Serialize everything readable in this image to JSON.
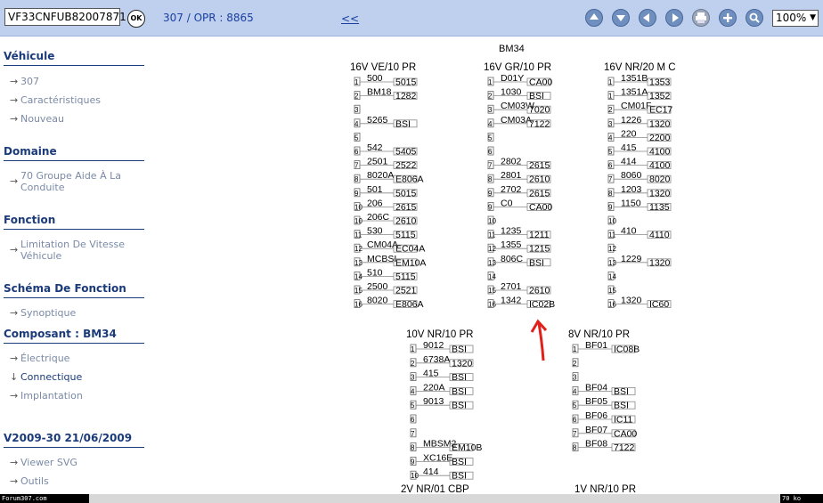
{
  "toolbar": {
    "vin": "VF33CNFUB82007871",
    "ok_label": "OK",
    "breadcrumb": "307  /  OPR : 8865",
    "back_link": "<<",
    "zoom": "100%",
    "buttons": [
      "arrow-up-icon",
      "arrow-down-icon",
      "arrow-left-icon",
      "arrow-right-icon",
      "print-icon",
      "plus-icon",
      "magnifier-icon"
    ]
  },
  "sidebar": {
    "vehicule": {
      "title": "Véhicule",
      "items": [
        "307",
        "Caractéristiques",
        "Nouveau"
      ]
    },
    "domaine": {
      "title": "Domaine",
      "items": [
        "70 Groupe Aide À La Conduite"
      ]
    },
    "fonction": {
      "title": "Fonction",
      "items": [
        "Limitation De Vitesse Véhicule"
      ]
    },
    "schema": {
      "title": "Schéma De Fonction",
      "items": [
        "Synoptique"
      ]
    },
    "composant": {
      "title": "Composant : BM34",
      "items": [
        "Électrique",
        "Connectique",
        "Implantation"
      ]
    },
    "version": {
      "title": "V2009-30 21/06/2009",
      "items": [
        "Viewer SVG",
        "Outils"
      ]
    }
  },
  "status": {
    "left": "Forum307.com",
    "right": "70 ko"
  },
  "diagram": {
    "component": "BM34",
    "connectors": [
      {
        "title": "16V VE/10 PR",
        "pins": [
          {
            "n": "1",
            "wire": "500",
            "dest": "5015"
          },
          {
            "n": "2",
            "wire": "BM18",
            "dest": "1282"
          },
          {
            "n": "3",
            "wire": "",
            "dest": ""
          },
          {
            "n": "4",
            "wire": "5265",
            "dest": "BSI"
          },
          {
            "n": "5",
            "wire": "",
            "dest": ""
          },
          {
            "n": "6",
            "wire": "542",
            "dest": "5405"
          },
          {
            "n": "7",
            "wire": "2501",
            "dest": "2522"
          },
          {
            "n": "8",
            "wire": "8020A",
            "dest": "E806A"
          },
          {
            "n": "9",
            "wire": "501",
            "dest": "5015"
          },
          {
            "n": "10",
            "wire": "206",
            "dest": "2615"
          },
          {
            "n": "10",
            "wire": "206C",
            "dest": "2610"
          },
          {
            "n": "11",
            "wire": "530",
            "dest": "5115"
          },
          {
            "n": "12",
            "wire": "CM04A",
            "dest": "EC04A"
          },
          {
            "n": "13",
            "wire": "MCBSI",
            "dest": "EM10A"
          },
          {
            "n": "14",
            "wire": "510",
            "dest": "5115"
          },
          {
            "n": "15",
            "wire": "2500",
            "dest": "2521"
          },
          {
            "n": "16",
            "wire": "8020",
            "dest": "E806A"
          }
        ]
      },
      {
        "title": "16V GR/10 PR",
        "pins": [
          {
            "n": "1",
            "wire": "D01Y",
            "dest": "CA00"
          },
          {
            "n": "2",
            "wire": "1030",
            "dest": "BSI"
          },
          {
            "n": "3",
            "wire": "CM03W",
            "dest": "7020"
          },
          {
            "n": "4",
            "wire": "CM03A",
            "dest": "7122"
          },
          {
            "n": "5",
            "wire": "",
            "dest": ""
          },
          {
            "n": "6",
            "wire": "",
            "dest": ""
          },
          {
            "n": "7",
            "wire": "2802",
            "dest": "2615"
          },
          {
            "n": "8",
            "wire": "2801",
            "dest": "2610"
          },
          {
            "n": "9",
            "wire": "2702",
            "dest": "2615"
          },
          {
            "n": "9",
            "wire": "C0",
            "dest": "CA00"
          },
          {
            "n": "10",
            "wire": "",
            "dest": ""
          },
          {
            "n": "11",
            "wire": "1235",
            "dest": "1211"
          },
          {
            "n": "12",
            "wire": "1355",
            "dest": "1215"
          },
          {
            "n": "13",
            "wire": "806C",
            "dest": "BSI"
          },
          {
            "n": "14",
            "wire": "",
            "dest": ""
          },
          {
            "n": "15",
            "wire": "2701",
            "dest": "2610"
          },
          {
            "n": "16",
            "wire": "1342",
            "dest": "IC02B"
          }
        ]
      },
      {
        "title": "16V NR/20 M C",
        "pins": [
          {
            "n": "1",
            "wire": "1351B",
            "dest": "1353"
          },
          {
            "n": "1",
            "wire": "1351A",
            "dest": "1352"
          },
          {
            "n": "2",
            "wire": "CM01F",
            "dest": "EC17"
          },
          {
            "n": "3",
            "wire": "1226",
            "dest": "1320"
          },
          {
            "n": "4",
            "wire": "220",
            "dest": "2200"
          },
          {
            "n": "5",
            "wire": "415",
            "dest": "4100"
          },
          {
            "n": "6",
            "wire": "414",
            "dest": "4100"
          },
          {
            "n": "7",
            "wire": "8060",
            "dest": "8020"
          },
          {
            "n": "8",
            "wire": "1203",
            "dest": "1320"
          },
          {
            "n": "9",
            "wire": "1150",
            "dest": "1135"
          },
          {
            "n": "10",
            "wire": "",
            "dest": ""
          },
          {
            "n": "11",
            "wire": "410",
            "dest": "4110"
          },
          {
            "n": "12",
            "wire": "",
            "dest": ""
          },
          {
            "n": "13",
            "wire": "1229",
            "dest": "1320"
          },
          {
            "n": "14",
            "wire": "",
            "dest": ""
          },
          {
            "n": "15",
            "wire": "",
            "dest": ""
          },
          {
            "n": "16",
            "wire": "1320",
            "dest": "IC60"
          }
        ]
      },
      {
        "title": "10V NR/10 PR",
        "pins": [
          {
            "n": "1",
            "wire": "9012",
            "dest": "BSI"
          },
          {
            "n": "2",
            "wire": "6738A",
            "dest": "1320"
          },
          {
            "n": "3",
            "wire": "415",
            "dest": "BSI"
          },
          {
            "n": "4",
            "wire": "220A",
            "dest": "BSI"
          },
          {
            "n": "5",
            "wire": "9013",
            "dest": "BSI"
          },
          {
            "n": "6",
            "wire": "",
            "dest": ""
          },
          {
            "n": "7",
            "wire": "",
            "dest": ""
          },
          {
            "n": "8",
            "wire": "MBSM2",
            "dest": "EM10B"
          },
          {
            "n": "9",
            "wire": "XC16E",
            "dest": "BSI"
          },
          {
            "n": "10",
            "wire": "414",
            "dest": "BSI"
          }
        ]
      },
      {
        "title": "8V NR/10 PR",
        "pins": [
          {
            "n": "1",
            "wire": "BF01",
            "dest": "IC08B"
          },
          {
            "n": "2",
            "wire": "",
            "dest": ""
          },
          {
            "n": "3",
            "wire": "",
            "dest": ""
          },
          {
            "n": "4",
            "wire": "BF04",
            "dest": "BSI"
          },
          {
            "n": "5",
            "wire": "BF05",
            "dest": "BSI"
          },
          {
            "n": "6",
            "wire": "BF06",
            "dest": "IC11"
          },
          {
            "n": "7",
            "wire": "BF07",
            "dest": "CA00"
          },
          {
            "n": "8",
            "wire": "BF08",
            "dest": "7122"
          }
        ]
      },
      {
        "title": "2V NR/01 CBP",
        "pins": []
      },
      {
        "title": "1V NR/10 PR",
        "pins": []
      }
    ]
  }
}
